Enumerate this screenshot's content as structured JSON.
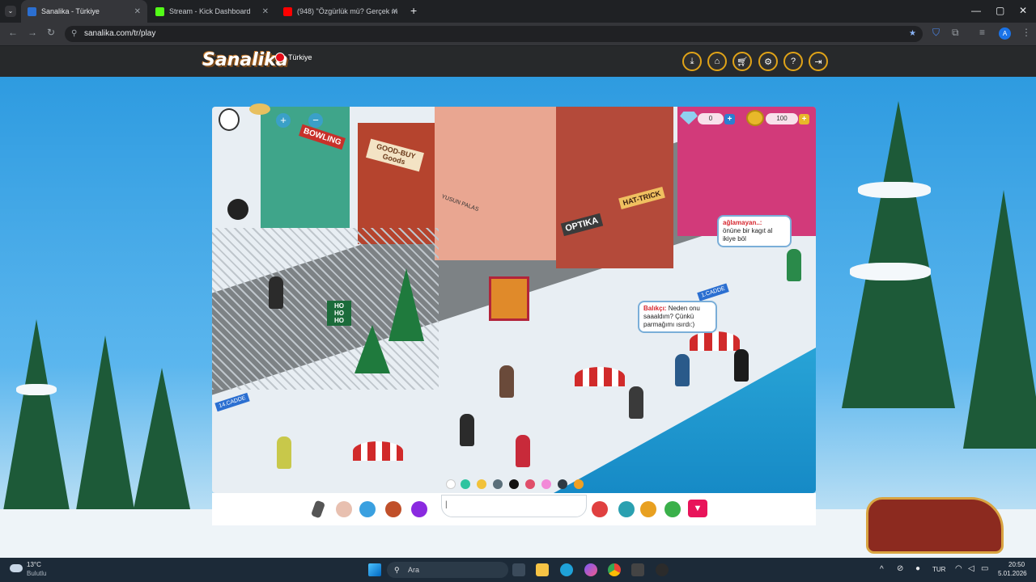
{
  "browser": {
    "tabs": [
      {
        "title": "Sanalika - Türkiye",
        "favicon_color": "#2b6fd1",
        "active": true
      },
      {
        "title": "Stream - Kick Dashboard",
        "favicon_color": "#53fc18",
        "active": false
      },
      {
        "title": "(948) \"Özgürlük mü? Gerçek m",
        "favicon_color": "#ff0000",
        "active": false
      }
    ],
    "new_tab": "+",
    "url": "sanalika.com/tr/play"
  },
  "site": {
    "logo": "Sanalika",
    "language": "Türkiye",
    "header_buttons": [
      "download-icon",
      "home-icon",
      "cart-icon",
      "gear-icon",
      "help-icon",
      "logout-icon"
    ]
  },
  "game": {
    "diamonds": "0",
    "coins": "100",
    "signs": {
      "bowling": "BOWLING",
      "goodbuy": "GOOD-BUY Goods",
      "optika": "OPTIKA",
      "hattrick": "HAT-TRICK",
      "palas": "YUSUN PALAS",
      "caddeA": "14.CADDE",
      "caddeB": "1.CADDE",
      "hoho": "HO HO HO"
    },
    "bubble1": {
      "name": "ağlamayan..:",
      "text": "önüne bir kagıt al ikiye böl"
    },
    "bubble2": {
      "name": "Balıkçı:",
      "text": "Neden onu saaaldım? Çünkü parmağımı ısırdı:)"
    },
    "palette": [
      "#ffffff",
      "#2ec4a0",
      "#f2c23a",
      "#5a6f7a",
      "#111111",
      "#e04e6a",
      "#f28ad8",
      "#2f3a44",
      "#f0a022"
    ],
    "chat_placeholder": "|",
    "tools_left": [
      "pen-icon",
      "emote-icon",
      "dance-icon",
      "gift-icon",
      "action-icon"
    ],
    "tools_right": [
      "chat-bubble-icon",
      "friends-icon",
      "trophy-icon",
      "island-icon",
      "menu-triangle-icon"
    ]
  },
  "taskbar": {
    "weather_temp": "13°C",
    "weather_text": "Bulutlu",
    "search": "Ara",
    "lang": "TUR",
    "time": "20:50",
    "date": "5.01.2026"
  }
}
